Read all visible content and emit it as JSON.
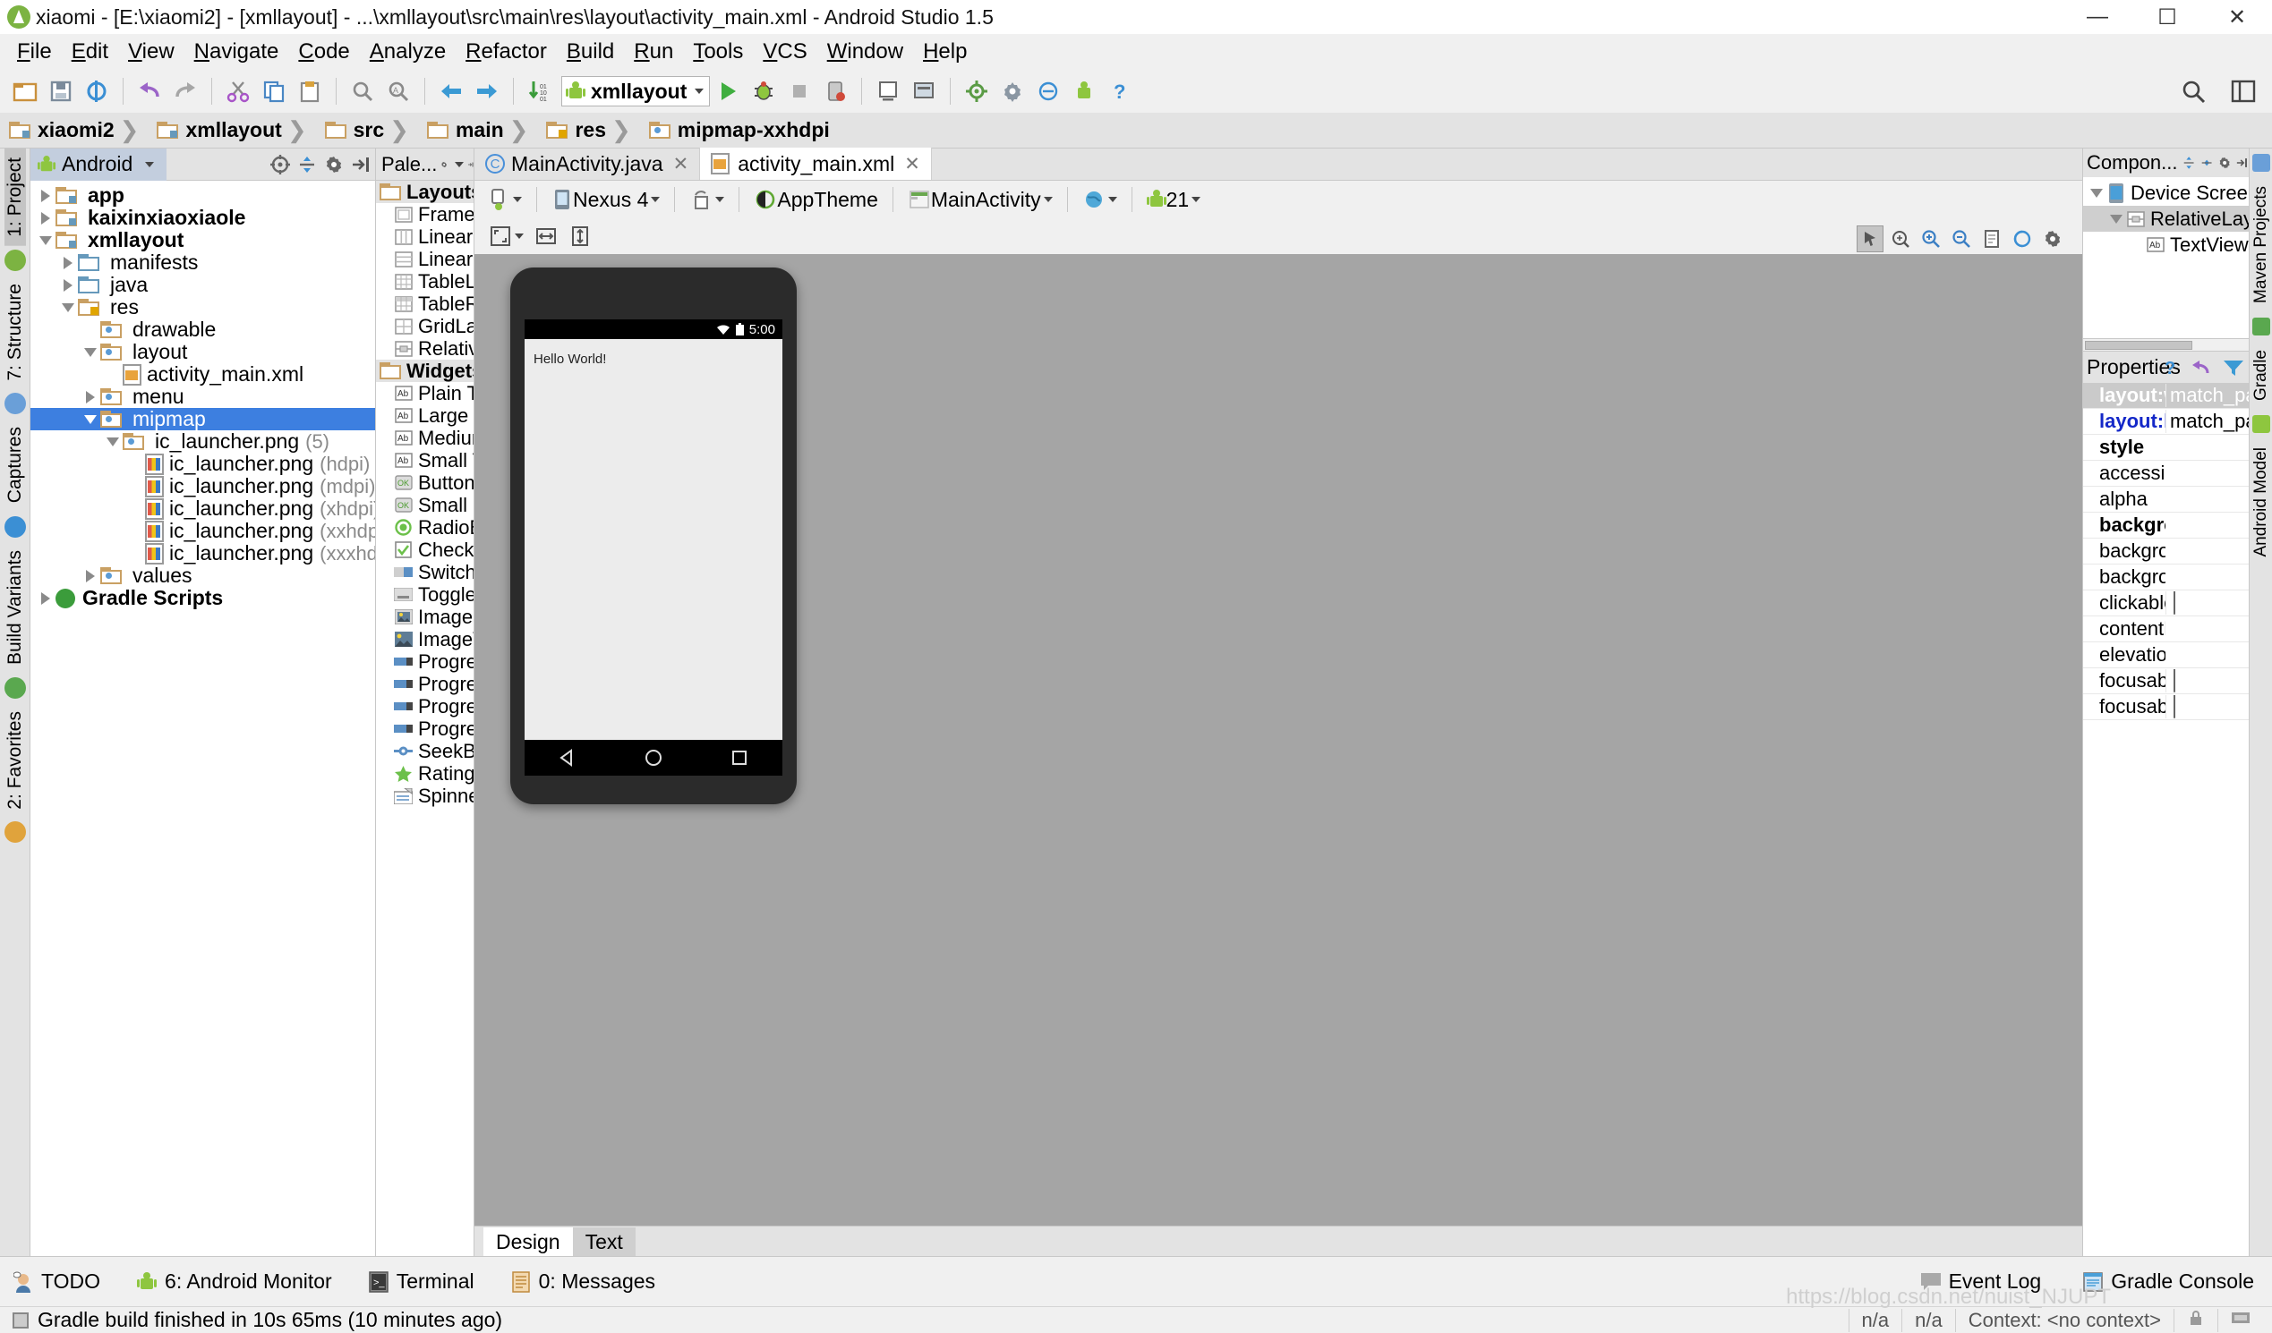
{
  "window": {
    "title": "xiaomi - [E:\\xiaomi2] - [xmllayout] - ...\\xmllayout\\src\\main\\res\\layout\\activity_main.xml - Android Studio 1.5",
    "minimize": "—",
    "maximize": "☐",
    "close": "✕"
  },
  "menubar": [
    "File",
    "Edit",
    "View",
    "Navigate",
    "Code",
    "Analyze",
    "Refactor",
    "Build",
    "Run",
    "Tools",
    "VCS",
    "Window",
    "Help"
  ],
  "toolbar": {
    "run_config": "xmllayout",
    "icons": [
      "open-folder-icon",
      "save-all-icon",
      "sync-icon",
      "undo-icon",
      "redo-icon",
      "cut-icon",
      "copy-icon",
      "paste-icon",
      "find-icon",
      "replace-icon",
      "back-icon",
      "forward-icon",
      "gradle-sync-icon",
      "run-icon",
      "debug-icon",
      "stop-icon",
      "attach-debugger-icon",
      "avd-manager-icon",
      "sdk-manager-icon",
      "project-structure-icon",
      "settings-icon",
      "android-device-monitor-icon",
      "help-icon"
    ],
    "search_icon": "search-icon",
    "layout_icon": "layout-icon"
  },
  "breadcrumb": [
    {
      "label": "xiaomi2",
      "icon": "module-folder-icon"
    },
    {
      "label": "xmllayout",
      "icon": "module-folder-icon"
    },
    {
      "label": "src",
      "icon": "folder-icon"
    },
    {
      "label": "main",
      "icon": "folder-icon"
    },
    {
      "label": "res",
      "icon": "res-folder-icon"
    },
    {
      "label": "mipmap-xxhdpi",
      "icon": "mipmap-folder-icon"
    }
  ],
  "left_strip": [
    "1: Project",
    "7: Structure",
    "Captures",
    "Build Variants",
    "2: Favorites"
  ],
  "project": {
    "view_name": "Android",
    "header_icons": [
      "target-icon",
      "collapse-all-icon",
      "gear-icon",
      "hide-icon"
    ],
    "tree": [
      {
        "label": "app",
        "indent": 0,
        "twisty": "right",
        "icon": "module-folder-icon",
        "bold": true
      },
      {
        "label": "kaixinxiaoxiaole",
        "indent": 0,
        "twisty": "right",
        "icon": "module-folder-icon",
        "bold": true
      },
      {
        "label": "xmllayout",
        "indent": 0,
        "twisty": "down",
        "icon": "module-folder-icon",
        "bold": true
      },
      {
        "label": "manifests",
        "indent": 1,
        "twisty": "right",
        "icon": "folder-blue-icon"
      },
      {
        "label": "java",
        "indent": 1,
        "twisty": "right",
        "icon": "folder-blue-icon"
      },
      {
        "label": "res",
        "indent": 1,
        "twisty": "down",
        "icon": "res-folder-icon"
      },
      {
        "label": "drawable",
        "indent": 2,
        "twisty": "none",
        "icon": "mipmap-folder-icon"
      },
      {
        "label": "layout",
        "indent": 2,
        "twisty": "down",
        "icon": "mipmap-folder-icon"
      },
      {
        "label": "activity_main.xml",
        "indent": 3,
        "twisty": "none",
        "icon": "xml-file-icon"
      },
      {
        "label": "menu",
        "indent": 2,
        "twisty": "right",
        "icon": "mipmap-folder-icon"
      },
      {
        "label": "mipmap",
        "indent": 2,
        "twisty": "down",
        "icon": "mipmap-folder-icon",
        "selected": true
      },
      {
        "label": "ic_launcher.png",
        "sub": "(5)",
        "indent": 3,
        "twisty": "down",
        "icon": "mipmap-folder-icon"
      },
      {
        "label": "ic_launcher.png",
        "sub": "(hdpi)",
        "indent": 4,
        "twisty": "none",
        "icon": "png-file-icon"
      },
      {
        "label": "ic_launcher.png",
        "sub": "(mdpi)",
        "indent": 4,
        "twisty": "none",
        "icon": "png-file-icon"
      },
      {
        "label": "ic_launcher.png",
        "sub": "(xhdpi)",
        "indent": 4,
        "twisty": "none",
        "icon": "png-file-icon"
      },
      {
        "label": "ic_launcher.png",
        "sub": "(xxhdpi)",
        "indent": 4,
        "twisty": "none",
        "icon": "png-file-icon"
      },
      {
        "label": "ic_launcher.png",
        "sub": "(xxxhdpi)",
        "indent": 4,
        "twisty": "none",
        "icon": "png-file-icon"
      },
      {
        "label": "values",
        "indent": 2,
        "twisty": "right",
        "icon": "mipmap-folder-icon"
      },
      {
        "label": "Gradle Scripts",
        "indent": 0,
        "twisty": "right",
        "icon": "gradle-icon",
        "bold": true
      }
    ]
  },
  "palette": {
    "title": "Pale...",
    "header_icons": [
      "gear-icon",
      "hide-icon"
    ],
    "groups": [
      {
        "name": "Layouts",
        "items": [
          {
            "label": "FrameLa",
            "icon": "frame-layout-icon"
          },
          {
            "label": "LinearLa",
            "icon": "linear-layout-horizontal-icon"
          },
          {
            "label": "LinearLa",
            "icon": "linear-layout-vertical-icon"
          },
          {
            "label": "TableLa",
            "icon": "table-layout-icon"
          },
          {
            "label": "TableRo",
            "icon": "table-row-icon"
          },
          {
            "label": "GridLay",
            "icon": "grid-layout-icon"
          },
          {
            "label": "Relative",
            "icon": "relative-layout-icon"
          }
        ]
      },
      {
        "name": "Widgets",
        "items": [
          {
            "label": "Plain Te",
            "icon": "text-ab-icon"
          },
          {
            "label": "Large T",
            "icon": "text-ab-icon"
          },
          {
            "label": "Medium",
            "icon": "text-ab-icon"
          },
          {
            "label": "Small Te",
            "icon": "text-ab-icon"
          },
          {
            "label": "Button",
            "icon": "button-ok-icon"
          },
          {
            "label": "Small Bu",
            "icon": "button-ok-icon"
          },
          {
            "label": "RadioBu",
            "icon": "radio-button-icon"
          },
          {
            "label": "CheckB",
            "icon": "checkbox-icon"
          },
          {
            "label": "Switch",
            "icon": "switch-icon"
          },
          {
            "label": "ToggleB",
            "icon": "toggle-button-icon"
          },
          {
            "label": "ImageB",
            "icon": "image-button-icon"
          },
          {
            "label": "ImageV",
            "icon": "image-view-icon"
          },
          {
            "label": "Progres",
            "icon": "progressbar-icon"
          },
          {
            "label": "Progres",
            "icon": "progressbar-icon"
          },
          {
            "label": "Progres",
            "icon": "progressbar-icon"
          },
          {
            "label": "Progres",
            "icon": "progressbar-icon"
          },
          {
            "label": "SeekBar",
            "icon": "seekbar-icon"
          },
          {
            "label": "RatingB",
            "icon": "rating-star-icon"
          },
          {
            "label": "Spinner",
            "icon": "spinner-icon"
          }
        ]
      }
    ]
  },
  "editor": {
    "tabs": [
      {
        "label": "MainActivity.java",
        "icon": "java-class-icon",
        "active": false
      },
      {
        "label": "activity_main.xml",
        "icon": "xml-file-icon",
        "active": true
      }
    ],
    "design_toolbar": {
      "device": "Nexus 4",
      "theme": "AppTheme",
      "activity": "MainActivity",
      "api": "21",
      "locale_icon": "globe-icon",
      "orientation_icon": "orientation-icon",
      "config_icon": "config-icon",
      "zoom_icons": [
        "zoom-fit-icon",
        "fit-width-icon",
        "fit-height-icon"
      ],
      "right_icons": [
        "select-mode-icon",
        "pan-mode-icon",
        "zoom-in-icon",
        "zoom-out-icon",
        "render-icon",
        "refresh-icon",
        "settings-icon"
      ]
    },
    "preview": {
      "status_time": "5:00",
      "wifi_icon": "wifi-icon",
      "battery_icon": "battery-icon",
      "content_text": "Hello World!",
      "nav_back_icon": "nav-back-icon",
      "nav_home_icon": "nav-home-icon",
      "nav_recents_icon": "nav-recents-icon"
    },
    "bottom_tabs": [
      {
        "label": "Design",
        "active": true
      },
      {
        "label": "Text",
        "active": false
      }
    ]
  },
  "component_tree": {
    "title": "Compon...",
    "header_icons": [
      "expand-all-icon",
      "collapse-all-icon",
      "gear-icon",
      "hide-icon"
    ],
    "rows": [
      {
        "label": "Device Screen",
        "indent": 0,
        "twisty": "down",
        "icon": "device-screen-icon"
      },
      {
        "label": "RelativeLayout",
        "indent": 1,
        "twisty": "down",
        "icon": "relative-layout-icon",
        "selected": true
      },
      {
        "label": "TextView - \"H",
        "indent": 2,
        "twisty": "none",
        "icon": "text-ab-icon"
      }
    ]
  },
  "properties": {
    "title": "Properties",
    "header_icons": [
      "help-icon",
      "restore-default-icon",
      "filter-icon"
    ],
    "rows": [
      {
        "name": "layout:w",
        "value": "match_paren",
        "style": "selected"
      },
      {
        "name": "layout:h",
        "value": "match_paren",
        "style": "blue"
      },
      {
        "name": "style",
        "value": "",
        "style": "bold"
      },
      {
        "name": "accessibil",
        "value": "",
        "style": "normal"
      },
      {
        "name": "alpha",
        "value": "",
        "style": "normal"
      },
      {
        "name": "backgrou",
        "value": "",
        "style": "bold"
      },
      {
        "name": "backgrou",
        "value": "",
        "style": "normal"
      },
      {
        "name": "backgrou",
        "value": "",
        "style": "normal"
      },
      {
        "name": "clickable",
        "value": "",
        "style": "normal",
        "checkbox": true
      },
      {
        "name": "contentD",
        "value": "",
        "style": "normal"
      },
      {
        "name": "elevation",
        "value": "",
        "style": "normal"
      },
      {
        "name": "focusable",
        "value": "",
        "style": "normal",
        "checkbox": true
      },
      {
        "name": "focusable",
        "value": "",
        "style": "normal",
        "checkbox": true
      }
    ]
  },
  "right_strip": [
    "Maven Projects",
    "Gradle",
    "Android Model"
  ],
  "bottom_bar": {
    "left": [
      {
        "label": "TODO",
        "icon": "todo-icon"
      },
      {
        "label": "6: Android Monitor",
        "icon": "android-icon"
      },
      {
        "label": "Terminal",
        "icon": "terminal-icon"
      },
      {
        "label": "0: Messages",
        "icon": "messages-icon"
      }
    ],
    "right": [
      {
        "label": "Event Log",
        "icon": "event-log-icon"
      },
      {
        "label": "Gradle Console",
        "icon": "gradle-console-icon"
      }
    ]
  },
  "status_line": {
    "message": "Gradle build finished in 10s 65ms (10 minutes ago)",
    "cells": [
      "n/a",
      "n/a",
      "Context: <no context>"
    ],
    "icons": [
      "lock-icon",
      "memory-icon"
    ]
  },
  "watermark": "https://blog.csdn.net/nuist_NJUPT",
  "colors": {
    "selection_blue": "#3d7fe0",
    "panel_grey": "#e3e3e3",
    "canvas_grey": "#a5a5a5",
    "accent_green": "#7cb342",
    "folder_tan": "#c9a063"
  }
}
